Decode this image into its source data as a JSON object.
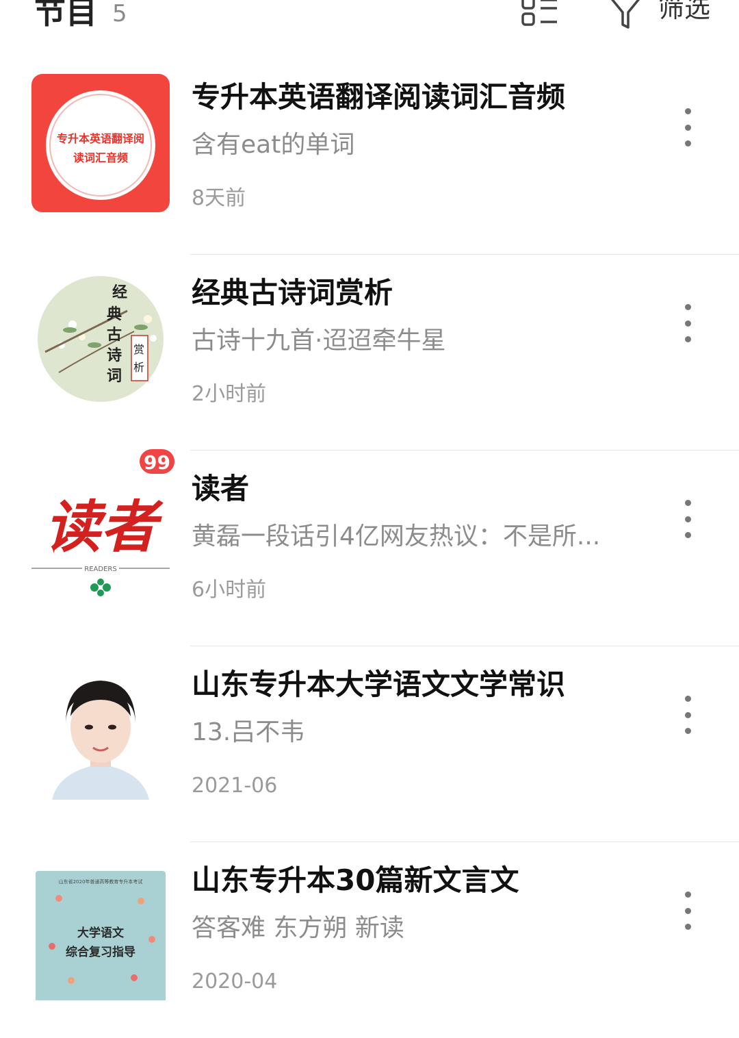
{
  "header": {
    "title": "节目",
    "count": "5",
    "list_icon": "list-view-icon",
    "filter_icon": "funnel-icon",
    "filter_label": "筛选"
  },
  "items": [
    {
      "title": "专升本英语翻译阅读词汇音频",
      "subtitle": "含有eat的单词",
      "time": "8天前",
      "cover_text": [
        "专升本英语翻译阅",
        "读词汇音频"
      ]
    },
    {
      "title": "经典古诗词赏析",
      "subtitle": "古诗十九首·迢迢牵牛星",
      "time": "2小时前",
      "cover_text": [
        "经典古诗词",
        "赏析"
      ]
    },
    {
      "title": "读者",
      "subtitle": "黄磊一段话引4亿网友热议：不是所...",
      "time": "6小时前",
      "badge": "99",
      "cover_text": [
        "读者",
        "READERS"
      ]
    },
    {
      "title": "山东专升本大学语文文学常识",
      "subtitle": "13.吕不韦",
      "time": "2021-06"
    },
    {
      "title": "山东专升本30篇新文言文",
      "subtitle": "答客难 东方朔 新读",
      "time": "2020-04",
      "cover_text": [
        "山东省2020年普通高等教育专升本考试",
        "大学语文",
        "综合复习指导"
      ]
    }
  ],
  "colors": {
    "accent_red": "#f04545",
    "title": "#111111",
    "secondary": "#8c8c8c",
    "divider": "#e8e8e8"
  }
}
